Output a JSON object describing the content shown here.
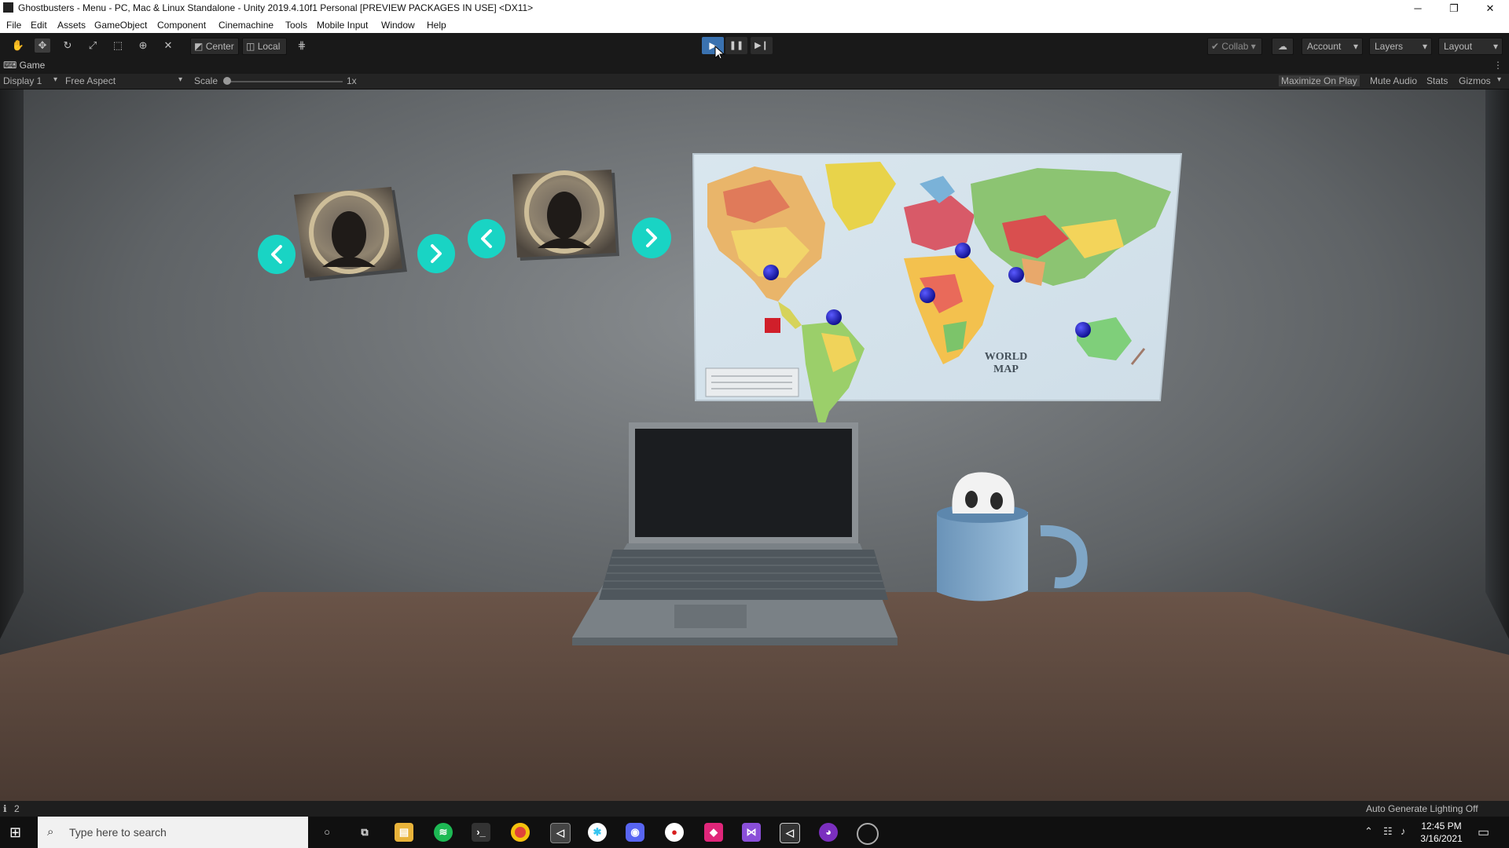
{
  "window": {
    "title": "Ghostbusters - Menu - PC, Mac & Linux Standalone - Unity 2019.4.10f1 Personal [PREVIEW PACKAGES IN USE] <DX11>",
    "minimize": "─",
    "restore": "❐",
    "close": "✕"
  },
  "menu": [
    "File",
    "Edit",
    "Assets",
    "GameObject",
    "Component",
    "Cinemachine",
    "Tools",
    "Mobile Input",
    "Window",
    "Help"
  ],
  "toolbar": {
    "pivot": "Center",
    "space": "Local",
    "collab": "Collab",
    "account": "Account",
    "layers": "Layers",
    "layout": "Layout"
  },
  "game_panel": {
    "tab": "Game",
    "display": "Display 1",
    "aspect": "Free Aspect",
    "scale_label": "Scale",
    "scale_value": "1x",
    "maximize": "Maximize On Play",
    "mute": "Mute Audio",
    "stats": "Stats",
    "gizmos": "Gizmos"
  },
  "scene": {
    "map_title_line1": "WORLD",
    "map_title_line2": "MAP",
    "accent": "#19d4c4",
    "pin_color": "#1a1acc",
    "marker_color": "#d01f2a"
  },
  "status": {
    "count": "2",
    "lighting": "Auto Generate Lighting Off"
  },
  "taskbar": {
    "search_placeholder": "Type here to search",
    "time": "12:45 PM",
    "date": "3/16/2021"
  }
}
